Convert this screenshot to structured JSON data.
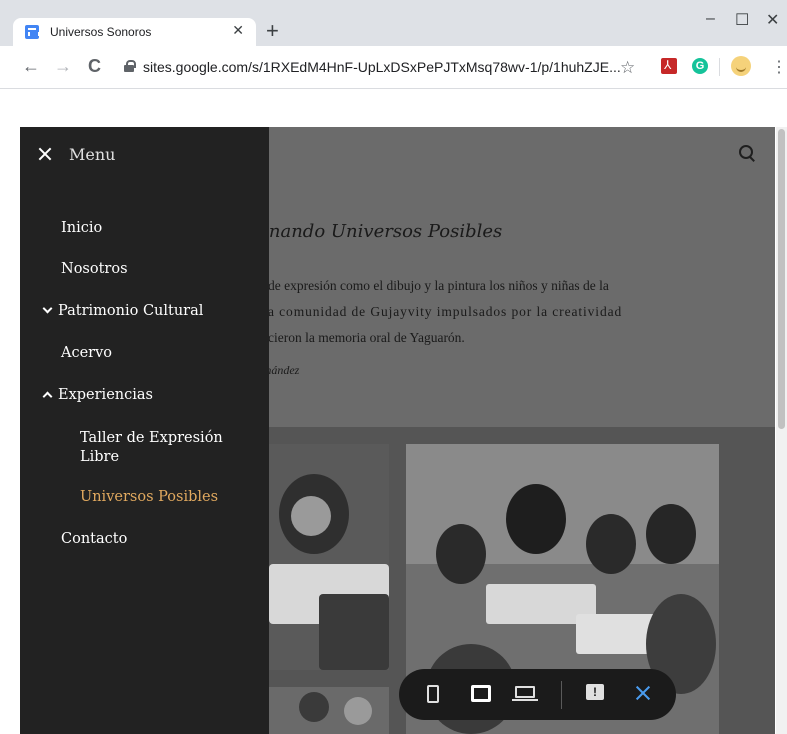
{
  "browser": {
    "tab_title": "Universos Sonoros",
    "tab_close": "✕",
    "new_tab": "+",
    "url": "sites.google.com/s/1RXEdM4HnF-UpLxDSxPePJTxMsq78wv-1/p/1huhZJE...",
    "window_controls": {
      "minimize": "–",
      "maximize": "☐",
      "close": "✕"
    },
    "nav": {
      "back": "←",
      "forward": "→",
      "reload": "C"
    },
    "star": "☆",
    "ext_g": "G",
    "kebab": "⋮"
  },
  "page": {
    "heading": "endo e Imaginando Universos Posibles",
    "paragraph_lines": [
      "de expresión como el dibujo y la pintura los niños y niñas de la",
      "a comunidad de Gujayvity impulsados por la creatividad",
      "cieron la memoria oral de Yaguarón."
    ],
    "author": "Fernández"
  },
  "menu": {
    "title": "Menu",
    "items": [
      {
        "label": "Inicio"
      },
      {
        "label": "Nosotros"
      },
      {
        "label": "Patrimonio Cultural",
        "chevron": "down"
      },
      {
        "label": "Acervo"
      },
      {
        "label": "Experiencias",
        "chevron": "up"
      },
      {
        "label": "Taller de Expresión Libre",
        "sub": true,
        "lines": [
          "Taller de Expresión",
          "Libre"
        ]
      },
      {
        "label": "Universos Posibles",
        "sub": true,
        "active": true
      },
      {
        "label": "Contacto"
      }
    ]
  },
  "preview_bar": {
    "feedback_glyph": "!"
  },
  "colors": {
    "active_menu": "#e1a95f",
    "menu_bg": "#222222",
    "preview_close": "#4a9cf0"
  }
}
